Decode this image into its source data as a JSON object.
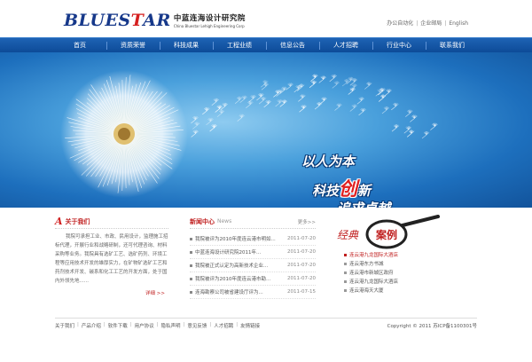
{
  "header": {
    "logo_word_1": "BLUES",
    "logo_word_2": "T",
    "logo_word_3": "AR",
    "logo_cn": "中蓝连海设计研究院",
    "logo_en": "China Bluestar Lehigh Engineering Corp",
    "top_links": [
      "办公自动化",
      "企业邮局",
      "English"
    ]
  },
  "nav": {
    "items": [
      "首页",
      "资质荣誉",
      "科技成果",
      "工程业绩",
      "信息公告",
      "人才招聘",
      "行业中心",
      "联系我们"
    ]
  },
  "banner": {
    "slogan_1": "以人为本",
    "slogan_2a": "科技",
    "slogan_2b": "创",
    "slogan_2c": "新",
    "slogan_3": "追求卓越"
  },
  "about": {
    "title": "关于我们",
    "text": "我院可承担工业、市政、民用设计，监理施工招标代理，开展行业和战略研制，还可代理咨询、材料采购等业务。我院具有选矿工艺、选矿药剂、环境工程等应用技术开发的雄厚实力，在矿物矿选矿工艺和药剂技术开发、碳系和化工工艺的开发方面，处于国内外领先地......",
    "detail": "详细 >>"
  },
  "news": {
    "title": "新闻中心",
    "subtitle": "News",
    "more": "更多>>",
    "items": [
      {
        "title": "我院被评为2010年度连云港市明如...",
        "date": "2011-07-20"
      },
      {
        "title": "中蓝连海设计研究院2011年...",
        "date": "2011-07-20"
      },
      {
        "title": "我院被正式认定为高新技术企业...",
        "date": "2011-07-20"
      },
      {
        "title": "我院被评为2010年度连云港市勘...",
        "date": "2011-07-20"
      },
      {
        "title": "连海勘察公司被省建设厅评为...",
        "date": "2011-07-15"
      }
    ]
  },
  "cases": {
    "title_1": "经典",
    "title_2": "案例",
    "items": [
      "连云港九龙国际大酒店",
      "连云港东方书城",
      "连云港市新城区政府",
      "连云港九龙国际大酒店",
      "连云港海天大厦"
    ]
  },
  "footer": {
    "links": [
      "关于我们",
      "产品介绍",
      "软件下载",
      "用户协议",
      "隐私声明",
      "意见反馈",
      "人才招聘",
      "友情链接"
    ],
    "copyright": "Copyright © 2011 苏ICP备1100301号"
  },
  "colors": {
    "brand_blue": "#16388a",
    "accent_red": "#c02020",
    "nav_blue": "#0d4b98"
  }
}
